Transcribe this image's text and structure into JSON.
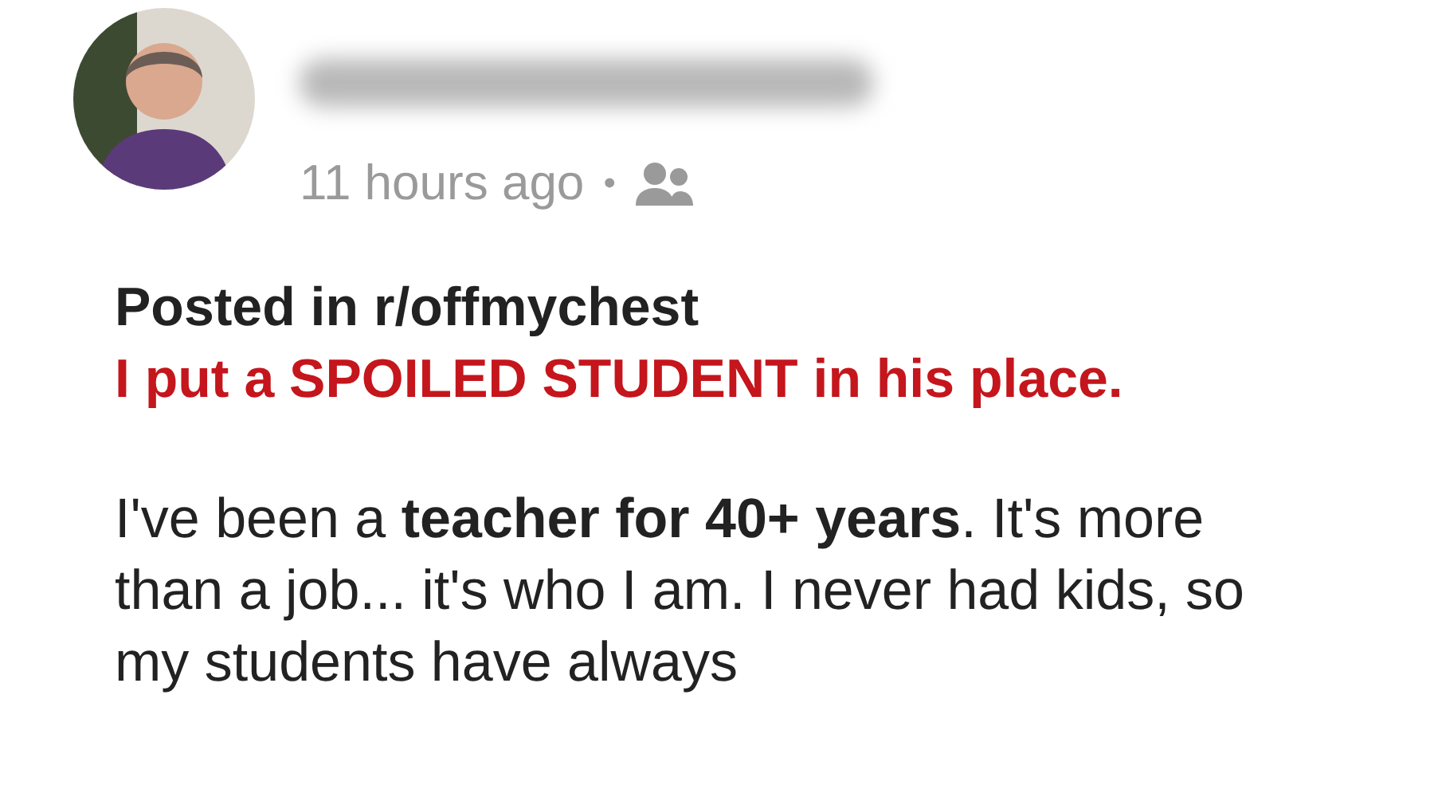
{
  "post": {
    "time": "11 hours ago",
    "separator": "•",
    "community_line": "Posted in r/offmychest",
    "title": "I put a SPOILED STUDENT in his place.",
    "body": "I've been a **teacher for 40+ years**. It's more than a job... it's who I am. I never had kids, so my students have always"
  }
}
